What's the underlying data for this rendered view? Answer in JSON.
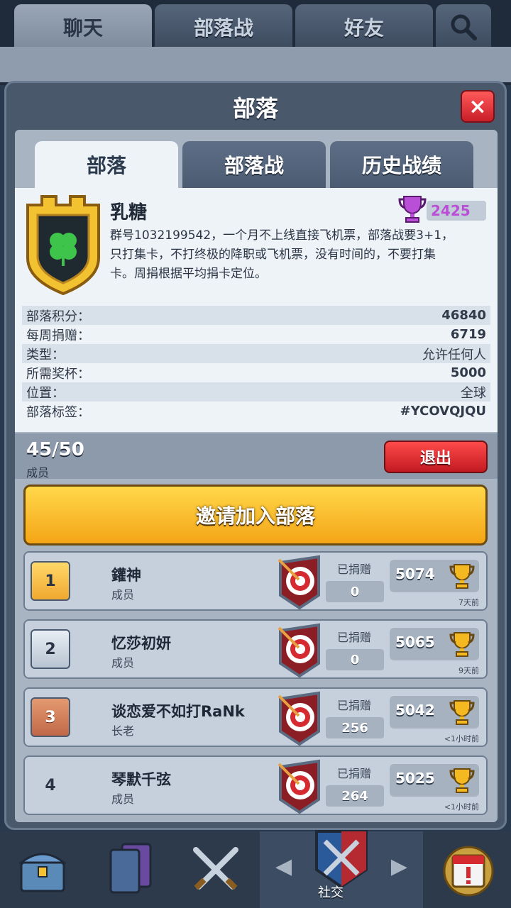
{
  "top_tabs": [
    {
      "label": "聊天",
      "active": true
    },
    {
      "label": "部落战",
      "active": false
    },
    {
      "label": "好友",
      "active": false
    }
  ],
  "modal": {
    "title": "部落",
    "close_icon": "×"
  },
  "sub_tabs": [
    {
      "label": "部落",
      "active": true
    },
    {
      "label": "部落战",
      "active": false
    },
    {
      "label": "历史战绩",
      "active": false
    }
  ],
  "clan": {
    "name": "乳糖",
    "trophies": "2425",
    "description_lines": [
      "群号1032199542，一个月不上线直接飞机票，部落战要3+1，",
      "只打集卡，不打终极的降职或飞机票，没有时间的，不要打集",
      "卡。周捐根据平均捐卡定位。"
    ]
  },
  "stats": [
    {
      "label": "部落积分：",
      "value": "46840"
    },
    {
      "label": "每周捐赠：",
      "value": "6719"
    },
    {
      "label": "类型：",
      "value": "允许任何人"
    },
    {
      "label": "所需奖杯：",
      "value": "5000"
    },
    {
      "label": "位置：",
      "value": "全球"
    },
    {
      "label": "部落标签：",
      "value": "#YCOVQJQU"
    }
  ],
  "members_summary": {
    "count": "45/50",
    "label": "成员",
    "leave_label": "退出",
    "invite_label": "邀请加入部落"
  },
  "members": [
    {
      "rank": "1",
      "name": "鑵神",
      "role": "成员",
      "donate_label": "已捐赠",
      "donated": "0",
      "trophies": "5074",
      "last_seen": "7天前"
    },
    {
      "rank": "2",
      "name": "忆莎初妍",
      "role": "成员",
      "donate_label": "已捐赠",
      "donated": "0",
      "trophies": "5065",
      "last_seen": "9天前"
    },
    {
      "rank": "3",
      "name": "谈恋爱不如打RaNk",
      "role": "长老",
      "donate_label": "已捐赠",
      "donated": "256",
      "trophies": "5042",
      "last_seen": "<1小时前"
    },
    {
      "rank": "4",
      "name": "琴默千弦",
      "role": "成员",
      "donate_label": "已捐赠",
      "donated": "264",
      "trophies": "5025",
      "last_seen": "<1小时前"
    }
  ],
  "bottom_nav": {
    "active_label": "社交",
    "icons": [
      "chest-icon",
      "cards-icon",
      "battle-swords-icon",
      "social-clan-icon",
      "events-icon"
    ]
  },
  "colors": {
    "accent_gold": "#f4a516",
    "danger_red": "#c81e28",
    "trophy_purple": "#b94fd6"
  }
}
